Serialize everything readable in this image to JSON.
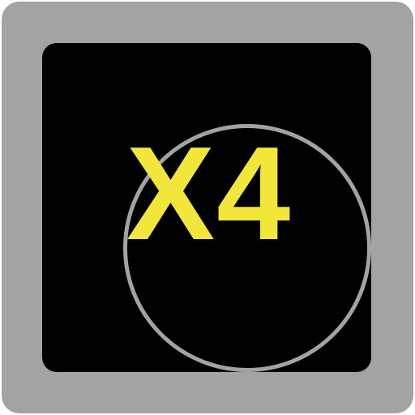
{
  "icon": {
    "name": "x4-multiplier-icon",
    "label": "X4",
    "colors": {
      "frame": "#a3a3a3",
      "face": "#000000",
      "ring": "#a3a3a3",
      "text": "#f2e63a"
    }
  }
}
